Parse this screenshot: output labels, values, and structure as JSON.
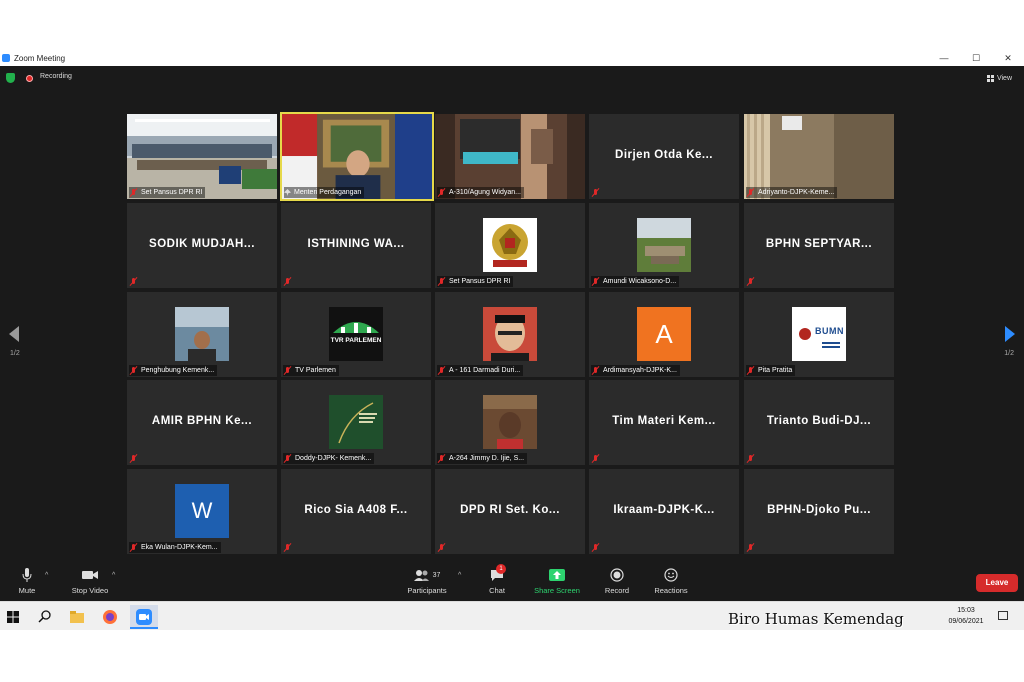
{
  "window": {
    "title": "Zoom Meeting",
    "controls": [
      "—",
      "☐",
      "✕"
    ]
  },
  "top_bar": {
    "recording_label": "Recording",
    "view_label": "View"
  },
  "pager": {
    "left_page": "1/2",
    "right_page": "1/2"
  },
  "tiles": [
    {
      "label": "Set Pansus DPR RI",
      "kind": "video"
    },
    {
      "label": "Menteri Perdagangan",
      "kind": "video",
      "active": true
    },
    {
      "label": "A-310/Agung Widyan...",
      "kind": "video"
    },
    {
      "label": "",
      "big": "Dirjen Otda Ke...",
      "kind": "name"
    },
    {
      "label": "Adriyanto-DJPK-Keme...",
      "kind": "video"
    },
    {
      "label": "",
      "big": "SODIK MUDJAH...",
      "kind": "name"
    },
    {
      "label": "",
      "big": "ISTHINING WA...",
      "kind": "name"
    },
    {
      "label": "Set Pansus DPR RI",
      "kind": "avatar"
    },
    {
      "label": "Amundi Wicaksono-D...",
      "kind": "avatar"
    },
    {
      "label": "",
      "big": "BPHN SEPTYAR...",
      "kind": "name"
    },
    {
      "label": "Penghubung Kemenk...",
      "kind": "avatar"
    },
    {
      "label": "TV Parlemen",
      "kind": "avatar"
    },
    {
      "label": "A - 161 Darmadi Duri...",
      "kind": "avatar"
    },
    {
      "label": "Ardimansyah-DJPK-K...",
      "kind": "avatar",
      "letter": "A"
    },
    {
      "label": "Pita Pratita",
      "kind": "avatar"
    },
    {
      "label": "",
      "big": "AMIR BPHN Ke...",
      "kind": "name"
    },
    {
      "label": "Doddy-DJPK- Kemenk...",
      "kind": "avatar"
    },
    {
      "label": "A-264 Jimmy D. Ijie, S...",
      "kind": "avatar"
    },
    {
      "label": "",
      "big": "Tim Materi Kem...",
      "kind": "name"
    },
    {
      "label": "",
      "big": "Trianto Budi-DJ...",
      "kind": "name"
    },
    {
      "label": "Eka Wulan-DJPK-Kem...",
      "kind": "avatar",
      "letter": "W"
    },
    {
      "label": "",
      "big": "Rico Sia A408  F...",
      "kind": "name"
    },
    {
      "label": "",
      "big": "DPD RI Set. Ko...",
      "kind": "name"
    },
    {
      "label": "",
      "big": "Ikraam-DJPK-K...",
      "kind": "name"
    },
    {
      "label": "",
      "big": "BPHN-Djoko Pu...",
      "kind": "name"
    }
  ],
  "avatar_text": {
    "tvr": "TVR PARLEMEN",
    "bumn": "BUMN"
  },
  "toolbar": {
    "mute": "Mute",
    "stop_video": "Stop Video",
    "participants": "Participants",
    "participants_count": "37",
    "chat": "Chat",
    "chat_badge": "1",
    "share_screen": "Share Screen",
    "record": "Record",
    "reactions": "Reactions",
    "leave": "Leave"
  },
  "taskbar": {
    "watermark": "Biro Humas Kemendag",
    "time": "15:03",
    "date": "09/06/2021"
  },
  "colors": {
    "background": "#1a1a1a",
    "tile": "#2b2b2b",
    "active_border": "#e6d94a",
    "share_green": "#2dd36f",
    "leave_red": "#d62b2b",
    "mic_off_red": "#e02828",
    "zoom_blue": "#2d8cff"
  }
}
